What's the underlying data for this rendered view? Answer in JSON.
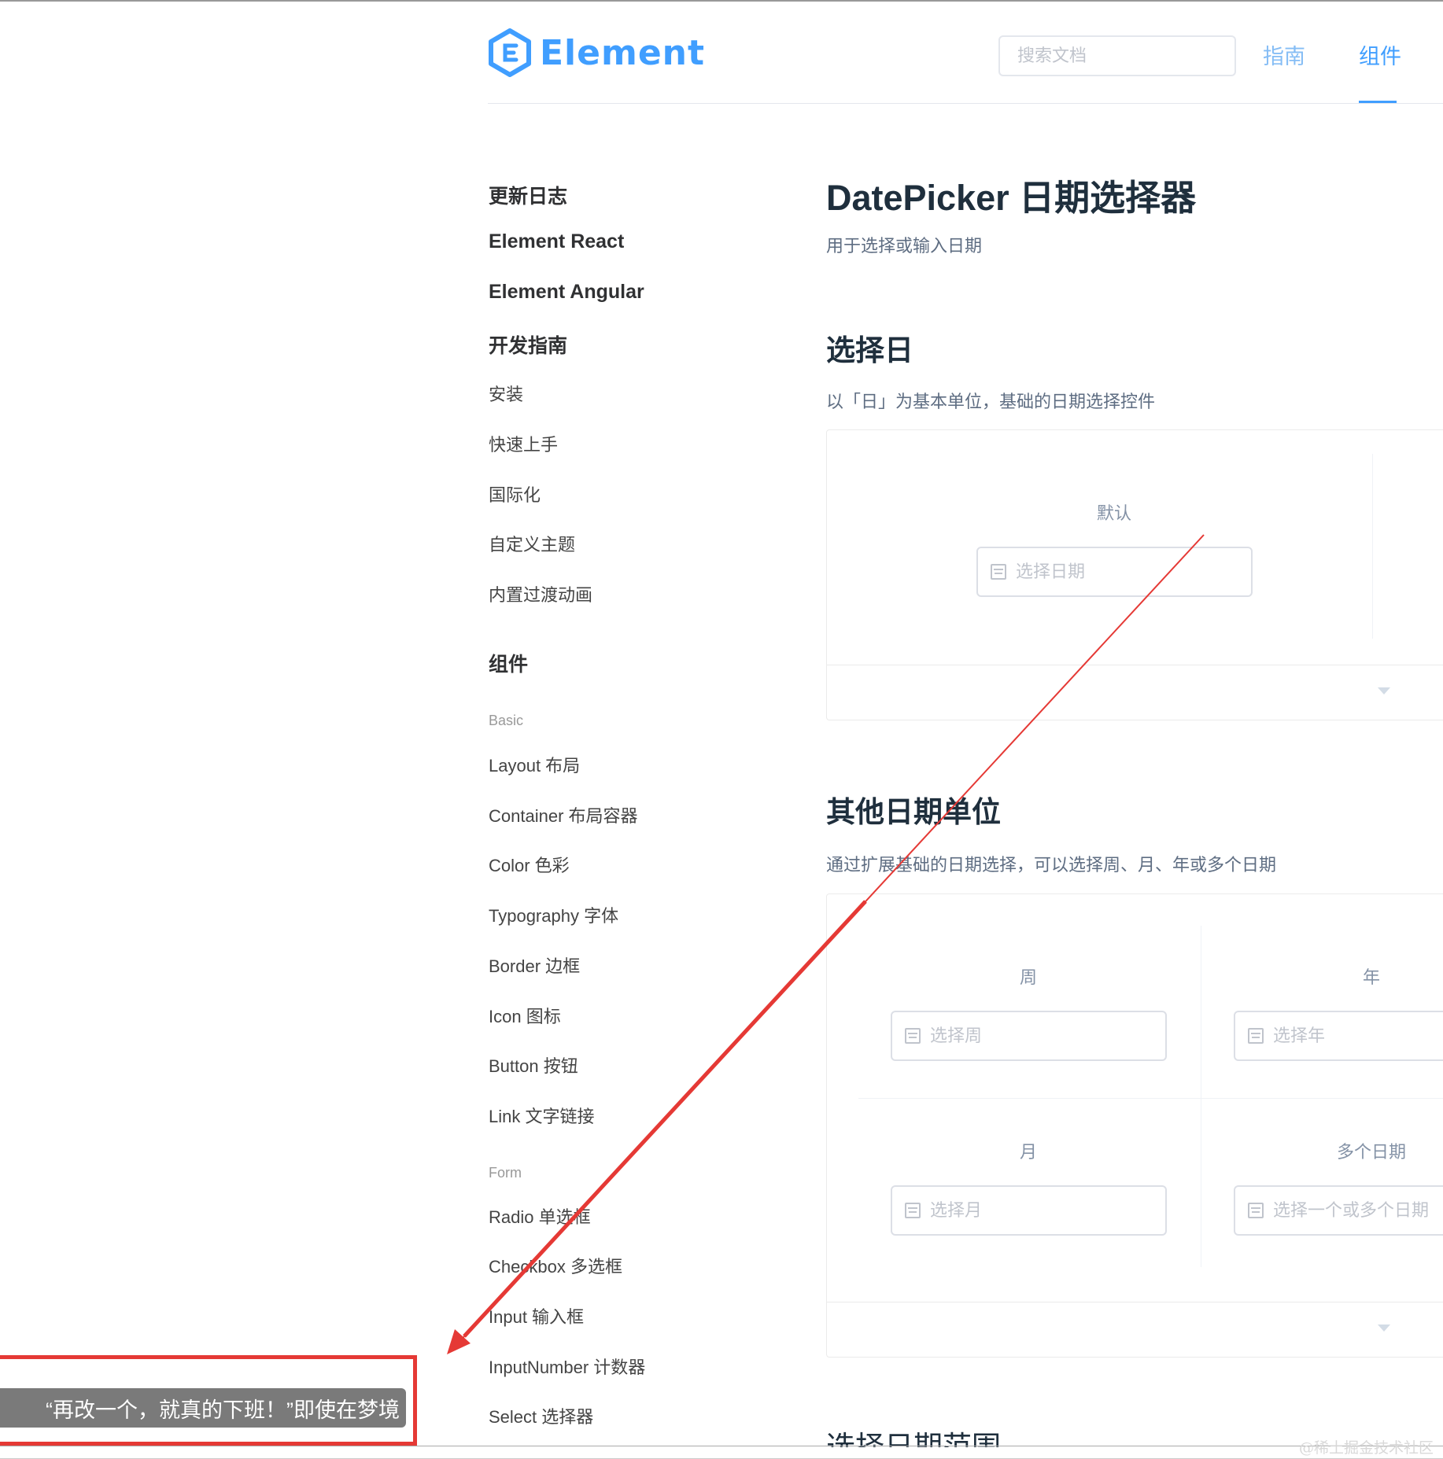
{
  "header": {
    "logo_text": "Element",
    "search_placeholder": "搜索文档",
    "nav": [
      {
        "label": "指南"
      },
      {
        "label": "组件"
      }
    ]
  },
  "sidebar": {
    "items": [
      "更新日志",
      "Element React",
      "Element Angular",
      "开发指南",
      "安装",
      "快速上手",
      "国际化",
      "自定义主题",
      "内置过渡动画",
      "组件",
      "Basic",
      "Layout 布局",
      "Container 布局容器",
      "Color 色彩",
      "Typography 字体",
      "Border 边框",
      "Icon 图标",
      "Button 按钮",
      "Link 文字链接",
      "Form",
      "Radio 单选框",
      "Checkbox 多选框",
      "Input 输入框",
      "InputNumber 计数器",
      "Select 选择器"
    ]
  },
  "content": {
    "title": "DatePicker 日期选择器",
    "subtitle": "用于选择或输入日期",
    "section1": {
      "title": "选择日",
      "desc": "以「日」为基本单位，基础的日期选择控件",
      "label": "默认",
      "placeholder": "选择日期"
    },
    "section2": {
      "title": "其他日期单位",
      "desc": "通过扩展基础的日期选择，可以选择周、月、年或多个日期",
      "week_label": "周",
      "week_placeholder": "选择周",
      "year_label": "年",
      "year_placeholder": "选择年",
      "month_label": "月",
      "month_placeholder": "选择月",
      "dates_label": "多个日期",
      "dates_placeholder": "选择一个或多个日期"
    },
    "section3": {
      "title": "选择日期范围"
    }
  },
  "toast": {
    "text": "“再改一个，就真的下班！”即使在梦境"
  },
  "watermark": "@稀土掘金技术社区",
  "colors": {
    "primary": "#409eff",
    "annotation": "#e53935"
  }
}
